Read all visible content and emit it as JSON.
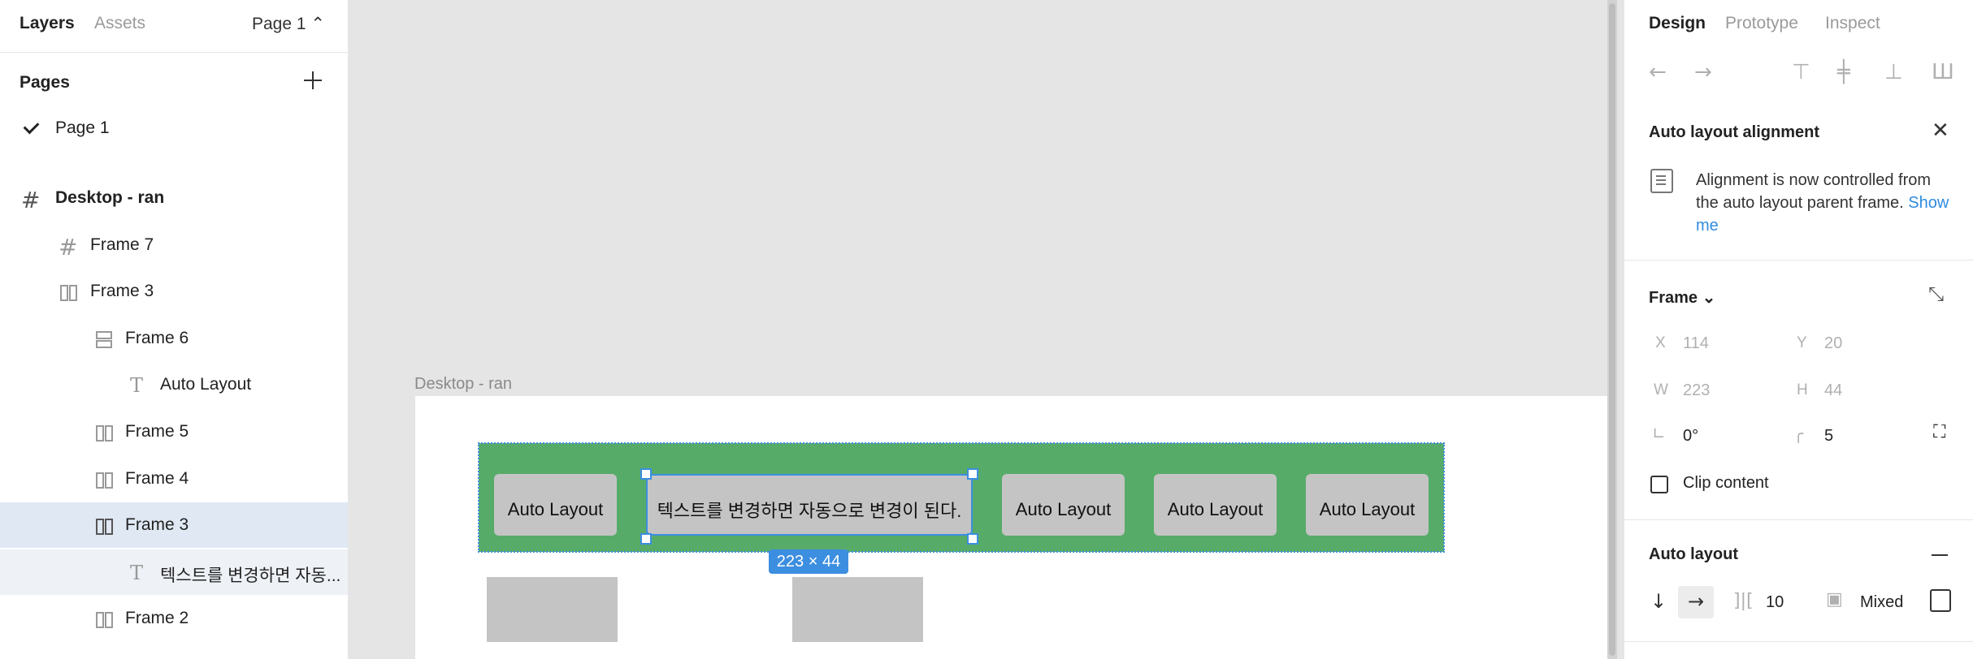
{
  "left_panel": {
    "tabs": {
      "layers": "Layers",
      "assets": "Assets"
    },
    "page_selector": "Page 1 ⌃",
    "pages_header": "Pages",
    "pages": [
      {
        "label": "Page 1"
      }
    ],
    "layers": [
      {
        "label": "Desktop - ran"
      },
      {
        "label": "Frame 7"
      },
      {
        "label": "Frame 3"
      },
      {
        "label": "Frame 6"
      },
      {
        "label": "Auto Layout"
      },
      {
        "label": "Frame 5"
      },
      {
        "label": "Frame 4"
      },
      {
        "label": "Frame 3"
      },
      {
        "label": "텍스트를 변경하면 자동..."
      },
      {
        "label": "Frame 2"
      }
    ]
  },
  "canvas": {
    "frame_label": "Desktop - ran",
    "buttons": [
      "Auto Layout",
      "텍스트를 변경하면 자동으로 변경이 된다.",
      "Auto Layout",
      "Auto Layout",
      "Auto Layout"
    ],
    "dimensions": "223 × 44"
  },
  "right_panel": {
    "tabs": {
      "design": "Design",
      "prototype": "Prototype",
      "inspect": "Inspect"
    },
    "alignment": {
      "title": "Auto layout alignment",
      "message": "Alignment is now controlled from the auto layout parent frame.",
      "link": "Show me"
    },
    "frame": {
      "title": "Frame ⌄",
      "x_label": "X",
      "x": "114",
      "y_label": "Y",
      "y": "20",
      "w_label": "W",
      "w": "223",
      "h_label": "H",
      "h": "44",
      "rotation": "0°",
      "radius": "5",
      "clip_content": "Clip content"
    },
    "auto_layout": {
      "title": "Auto layout",
      "spacing": "10",
      "padding": "Mixed"
    }
  }
}
